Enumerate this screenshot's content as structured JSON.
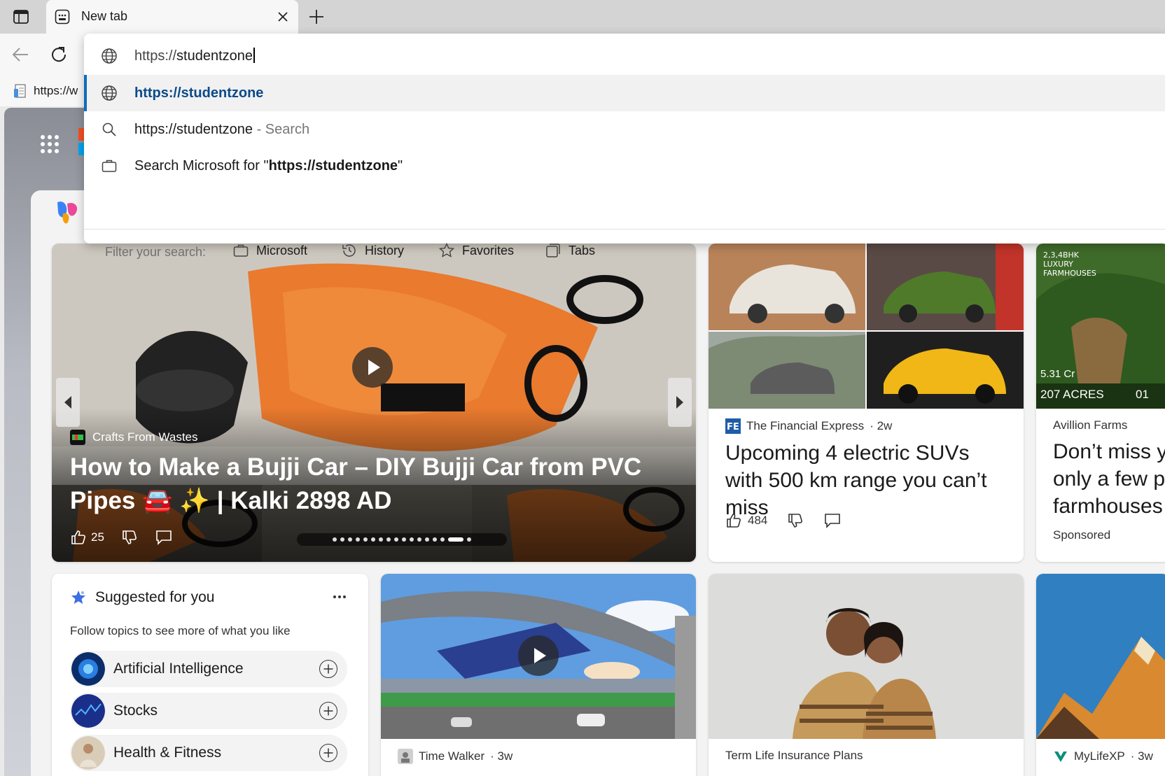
{
  "browser": {
    "tab_title": "New tab",
    "favorites_bar_item": "https://w"
  },
  "omnibox": {
    "typed_prefix": "https://",
    "typed_rest": "studentzone",
    "suggestions": [
      {
        "label": "https://studentzone",
        "type": "url"
      },
      {
        "label": "https://studentzone",
        "suffix": " - Search",
        "type": "search"
      },
      {
        "prefix": "Search Microsoft for \"",
        "bold": "https://studentzone",
        "end": "\"",
        "type": "work"
      }
    ],
    "filter_label": "Filter your search:",
    "filters": [
      "Microsoft",
      "History",
      "Favorites",
      "Tabs"
    ]
  },
  "feed": {
    "hero": {
      "source": "Crafts From Wastes",
      "title": "How to Make a Bujji Car – DIY Bujji Car from PVC Pipes 🚘 ✨ | Kalki 2898 AD",
      "likes": "25"
    },
    "suv": {
      "source": "The Financial Express",
      "age": "· 2w",
      "title": "Upcoming 4 electric SUVs with 500 km range you can’t miss",
      "likes": "484"
    },
    "farm": {
      "source": "Avillion Farms",
      "title_lines": [
        "Don’t miss y",
        "only a few p",
        "farmhouses"
      ],
      "sponsored": "Sponsored",
      "img_line1": "2,3,4BHK",
      "img_line2": "LUXURY",
      "img_line3": "FARMHOUSES",
      "img_price": "5.31 Cr",
      "img_acres": "207 ACRES",
      "img_units": "01"
    },
    "suggested": {
      "title": "Suggested for you",
      "subtitle": "Follow topics to see more of what you like",
      "topics": [
        "Artificial Intelligence",
        "Stocks",
        "Health & Fitness"
      ]
    },
    "train": {
      "source": "Time Walker",
      "age": "· 3w"
    },
    "insurance": {
      "source": "Term Life Insurance Plans"
    },
    "mountain": {
      "source": "MyLifeXP",
      "age": "· 3w"
    }
  }
}
